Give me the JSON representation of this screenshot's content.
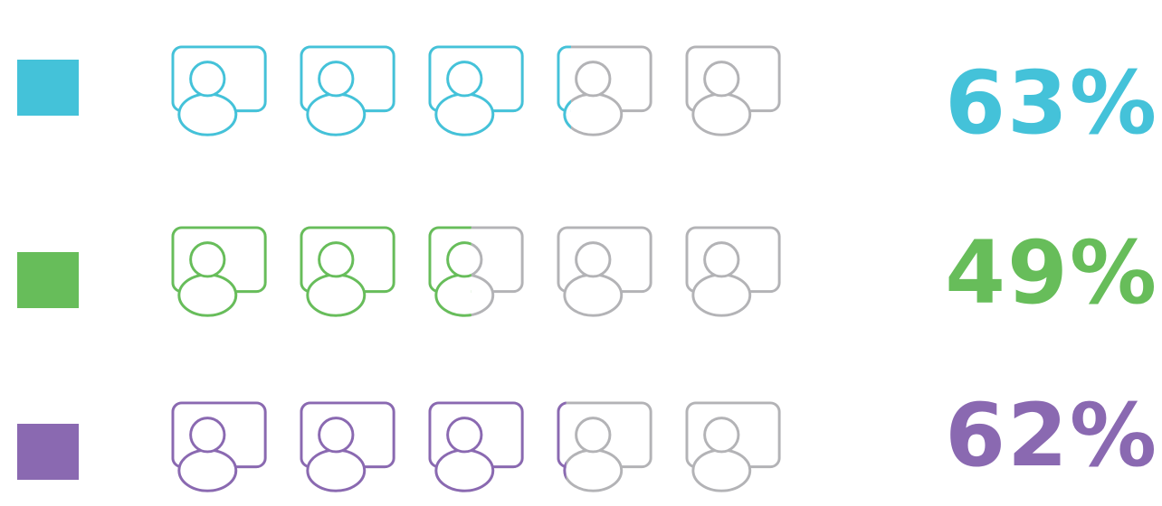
{
  "chart_data": {
    "type": "pictograph",
    "icons_per_row": 5,
    "inactive_color": "#b3b3b6",
    "icon": "user-profile-card-icon",
    "series": [
      {
        "value": 63,
        "label": "63%",
        "color": "#44c2d9"
      },
      {
        "value": 49,
        "label": "49%",
        "color": "#67bd5a"
      },
      {
        "value": 62,
        "label": "62%",
        "color": "#8a69b1"
      }
    ]
  }
}
